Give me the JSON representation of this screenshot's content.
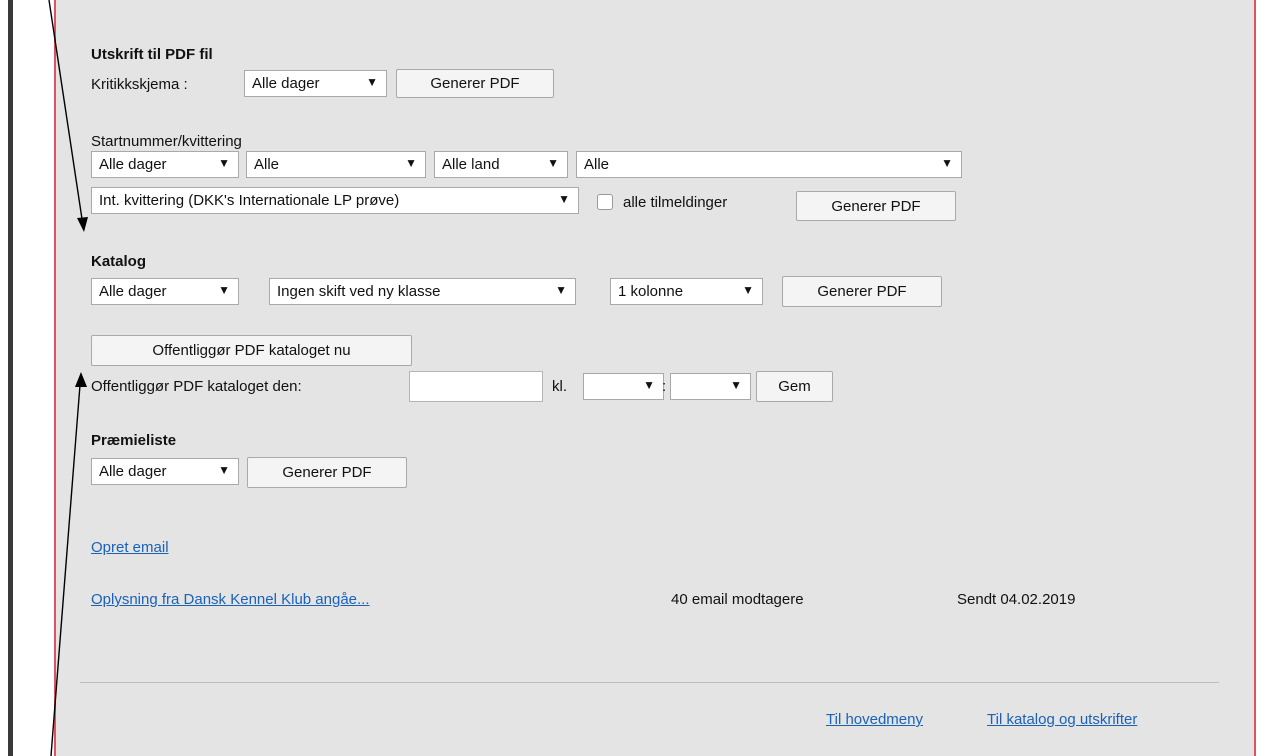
{
  "pdf_section": {
    "heading": "Utskrift til PDF fil",
    "kritikk_label": "Kritikkskjema :",
    "kritikk_select": "Alle dager",
    "generate": "Generer PDF"
  },
  "start_section": {
    "heading": "Startnummer/kvittering",
    "day_select": "Alle dager",
    "class_select": "Alle",
    "country_select": "Alle land",
    "all_select": "Alle",
    "receipt_select": "Int. kvittering (DKK's Internationale LP prøve)",
    "checkbox_label": "alle tilmeldinger",
    "generate": "Generer PDF"
  },
  "catalog_section": {
    "heading": "Katalog",
    "day_select": "Alle dager",
    "class_shift_select": "Ingen skift ved ny klasse",
    "columns_select": "1 kolonne",
    "generate": "Generer PDF",
    "publish_now": "Offentliggør PDF kataloget nu",
    "publish_date_label": "Offentliggør PDF kataloget den:",
    "publish_date_value": "",
    "kl_label": "kl.",
    "hour_select": "",
    "time_separator": ":",
    "minute_select": "",
    "save": "Gem"
  },
  "prize_section": {
    "heading": "Præmieliste",
    "day_select": "Alle dager",
    "generate": "Generer PDF"
  },
  "email": {
    "create_link": "Opret email",
    "item_subject": "Oplysning fra Dansk Kennel Klub angåe...",
    "item_recipients": "40 email modtagere",
    "item_sent": "Sendt 04.02.2019"
  },
  "footer": {
    "main_menu": "Til hovedmeny",
    "catalog_link": "Til katalog og utskrifter"
  },
  "icons": {
    "dropdown_arrow": "▼"
  },
  "colors": {
    "panel_bg": "#e4e4e4",
    "accent_border": "#e05260",
    "link": "#1a62b8"
  }
}
